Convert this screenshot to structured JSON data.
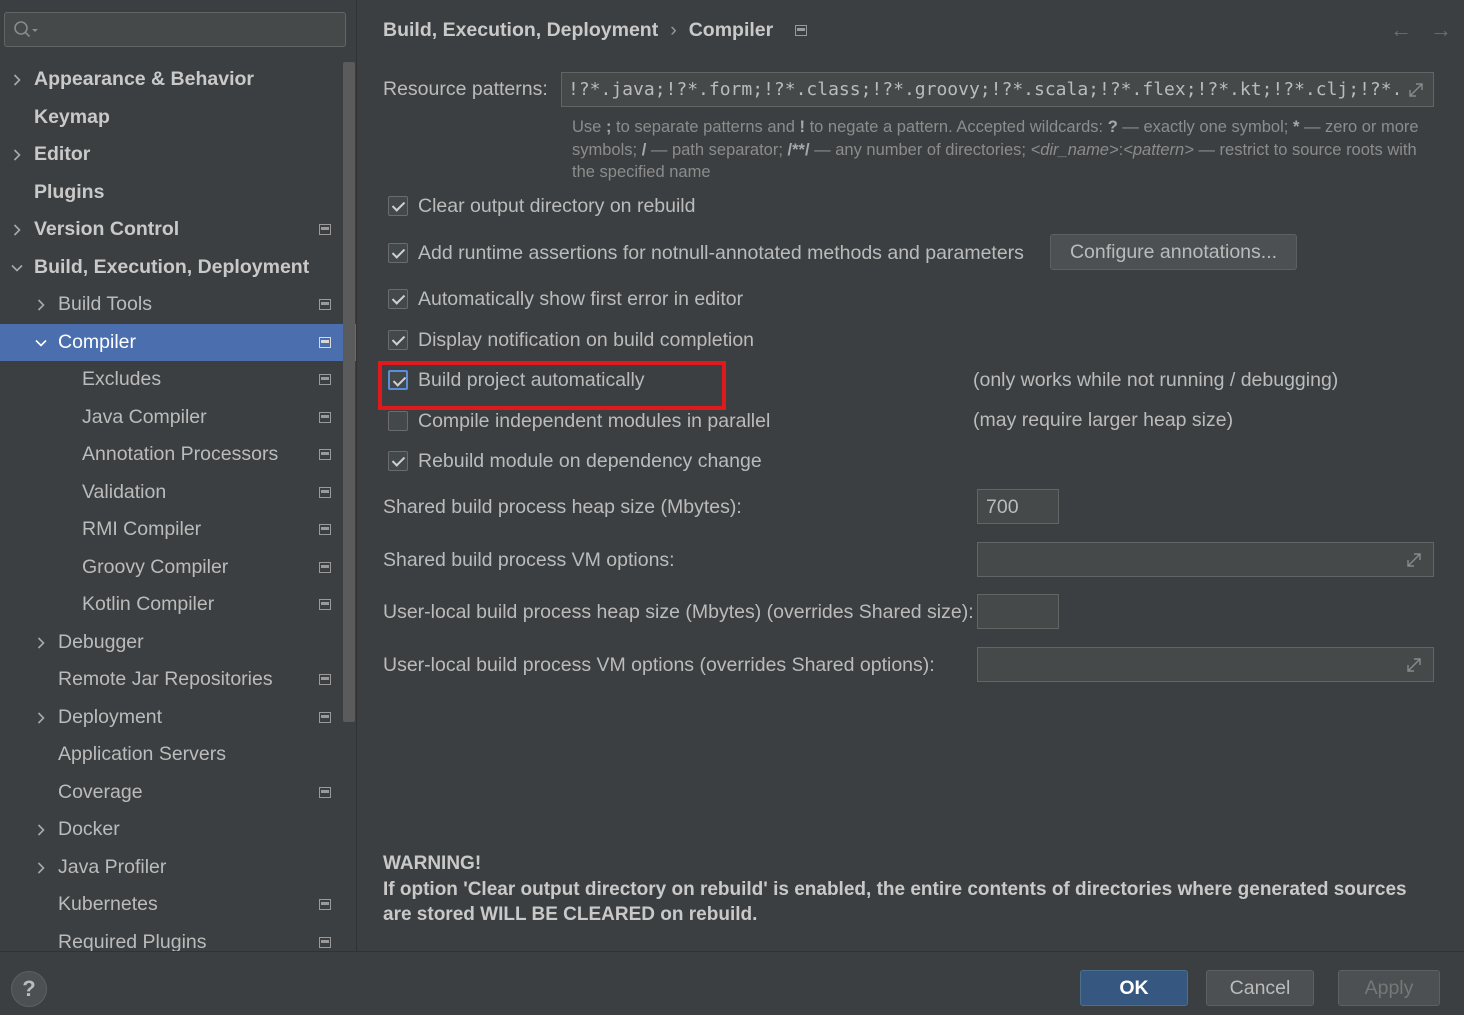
{
  "sidebar": {
    "search": {
      "placeholder": "",
      "value": ""
    },
    "items": [
      {
        "label": "Appearance & Behavior",
        "bold": true,
        "arrow": "right",
        "indent": 0,
        "project_icon": false
      },
      {
        "label": "Keymap",
        "bold": true,
        "arrow": "none",
        "indent": 0,
        "project_icon": false
      },
      {
        "label": "Editor",
        "bold": true,
        "arrow": "right",
        "indent": 0,
        "project_icon": false
      },
      {
        "label": "Plugins",
        "bold": true,
        "arrow": "none",
        "indent": 0,
        "project_icon": false
      },
      {
        "label": "Version Control",
        "bold": true,
        "arrow": "right",
        "indent": 0,
        "project_icon": true
      },
      {
        "label": "Build, Execution, Deployment",
        "bold": true,
        "arrow": "down",
        "indent": 0,
        "project_icon": false
      },
      {
        "label": "Build Tools",
        "bold": false,
        "arrow": "right",
        "indent": 1,
        "project_icon": true
      },
      {
        "label": "Compiler",
        "bold": false,
        "arrow": "down",
        "indent": 1,
        "project_icon": true,
        "selected": true
      },
      {
        "label": "Excludes",
        "bold": false,
        "arrow": "none",
        "indent": 2,
        "project_icon": true
      },
      {
        "label": "Java Compiler",
        "bold": false,
        "arrow": "none",
        "indent": 2,
        "project_icon": true
      },
      {
        "label": "Annotation Processors",
        "bold": false,
        "arrow": "none",
        "indent": 2,
        "project_icon": true
      },
      {
        "label": "Validation",
        "bold": false,
        "arrow": "none",
        "indent": 2,
        "project_icon": true
      },
      {
        "label": "RMI Compiler",
        "bold": false,
        "arrow": "none",
        "indent": 2,
        "project_icon": true
      },
      {
        "label": "Groovy Compiler",
        "bold": false,
        "arrow": "none",
        "indent": 2,
        "project_icon": true
      },
      {
        "label": "Kotlin Compiler",
        "bold": false,
        "arrow": "none",
        "indent": 2,
        "project_icon": true
      },
      {
        "label": "Debugger",
        "bold": false,
        "arrow": "right",
        "indent": 1,
        "project_icon": false
      },
      {
        "label": "Remote Jar Repositories",
        "bold": false,
        "arrow": "none",
        "indent": 1,
        "project_icon": true
      },
      {
        "label": "Deployment",
        "bold": false,
        "arrow": "right",
        "indent": 1,
        "project_icon": true
      },
      {
        "label": "Application Servers",
        "bold": false,
        "arrow": "none",
        "indent": 1,
        "project_icon": false
      },
      {
        "label": "Coverage",
        "bold": false,
        "arrow": "none",
        "indent": 1,
        "project_icon": true
      },
      {
        "label": "Docker",
        "bold": false,
        "arrow": "right",
        "indent": 1,
        "project_icon": false
      },
      {
        "label": "Java Profiler",
        "bold": false,
        "arrow": "right",
        "indent": 1,
        "project_icon": false
      },
      {
        "label": "Kubernetes",
        "bold": false,
        "arrow": "none",
        "indent": 1,
        "project_icon": true
      },
      {
        "label": "Required Plugins",
        "bold": false,
        "arrow": "none",
        "indent": 1,
        "project_icon": true
      }
    ]
  },
  "header": {
    "breadcrumb_parent": "Build, Execution, Deployment",
    "breadcrumb_separator": "›",
    "breadcrumb_current": "Compiler",
    "back_icon": "arrow-left-icon",
    "forward_icon": "arrow-right-icon"
  },
  "resource_patterns": {
    "label": "Resource patterns:",
    "value": "!?*.java;!?*.form;!?*.class;!?*.groovy;!?*.scala;!?*.flex;!?*.kt;!?*.clj;!?*.aj"
  },
  "hint": {
    "p1": "Use ",
    "semi": ";",
    "p2": " to separate patterns and ",
    "bang": "!",
    "p3": " to negate a pattern. Accepted wildcards: ",
    "q": "?",
    "p4": " — exactly one symbol; ",
    "star": "*",
    "p5": " — zero or more symbols; ",
    "slash": "/",
    "p6": " — path separator; ",
    "dstar": "/**/",
    "p7": " — any number of directories; ",
    "dir": "<dir_name>",
    "colon": ":",
    "pat": "<pattern>",
    "p8": " — restrict to source roots with the specified name"
  },
  "options": {
    "clear_output": {
      "label": "Clear output directory on rebuild",
      "checked": true
    },
    "runtime_assertions": {
      "label": "Add runtime assertions for notnull-annotated methods and parameters",
      "checked": true
    },
    "configure_annotations": "Configure annotations...",
    "show_first_error": {
      "label": "Automatically show first error in editor",
      "checked": true
    },
    "display_notification": {
      "label": "Display notification on build completion",
      "checked": true
    },
    "build_automatically": {
      "label": "Build project automatically",
      "checked": true,
      "note": "(only works while not running / debugging)"
    },
    "compile_parallel": {
      "label": "Compile independent modules in parallel",
      "checked": false,
      "note": "(may require larger heap size)"
    },
    "rebuild_module": {
      "label": "Rebuild module on dependency change",
      "checked": true
    }
  },
  "build_process": {
    "shared_heap_label": "Shared build process heap size (Mbytes):",
    "shared_heap_value": "700",
    "shared_vm_label": "Shared build process VM options:",
    "shared_vm_value": "",
    "user_heap_label": "User-local build process heap size (Mbytes) (overrides Shared size):",
    "user_heap_value": "",
    "user_vm_label": "User-local build process VM options (overrides Shared options):",
    "user_vm_value": ""
  },
  "warning": {
    "title": "WARNING!",
    "body": "If option 'Clear output directory on rebuild' is enabled, the entire contents of directories where generated sources are stored WILL BE CLEARED on rebuild."
  },
  "footer": {
    "help": "?",
    "ok": "OK",
    "cancel": "Cancel",
    "apply": "Apply"
  },
  "colors": {
    "background": "#3c3f41",
    "selection": "#4b6eaf",
    "highlight_box": "#e0191e",
    "ok_button": "#365880"
  }
}
